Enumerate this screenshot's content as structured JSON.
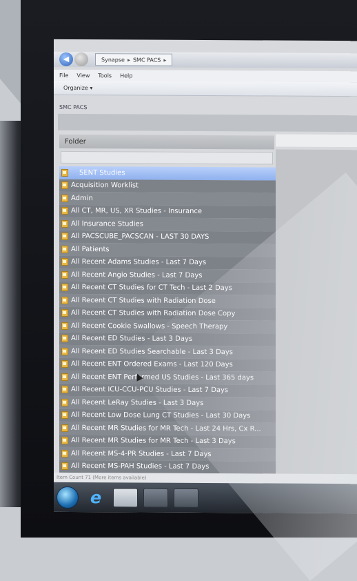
{
  "window": {
    "breadcrumb": [
      "Synapse",
      "SMC PACS"
    ],
    "menu": [
      "File",
      "View",
      "Tools",
      "Help"
    ],
    "toolbar_organize": "Organize ▾"
  },
  "pane": {
    "title": "SMC PACS",
    "folder_header": "Folder"
  },
  "folders": [
    "SENT Studies",
    "Acquisition Worklist",
    "Admin",
    "All CT, MR, US, XR Studies - Insurance",
    "All Insurance Studies",
    "All PACSCUBE_PACSCAN - LAST 30 DAYS",
    "All Patients",
    "All Recent Adams Studies - Last 7 Days",
    "All Recent Angio Studies - Last 7 Days",
    "All Recent CT Studies for CT Tech - Last 2 Days",
    "All Recent CT Studies with Radiation Dose",
    "All Recent CT Studies with Radiation Dose Copy",
    "All Recent Cookie Swallows - Speech Therapy",
    "All Recent ED Studies - Last 3 Days",
    "All Recent ED Studies Searchable - Last 3 Days",
    "All Recent ENT Ordered Exams - Last 120 Days",
    "All Recent ENT Performed US Studies - Last 365 days",
    "All Recent ICU-CCU-PCU Studies - Last 7 Days",
    "All Recent LeRay Studies - Last 3 Days",
    "All Recent Low Dose Lung CT Studies - Last 30 Days",
    "All Recent MR Studies for MR Tech - Last 24 Hrs, Cx R...",
    "All Recent MR Studies for MR Tech - Last 3 Days",
    "All Recent MS-4-PR Studies - Last 7 Days",
    "All Recent MS-PAH Studies - Last 7 Days"
  ],
  "selected_index": 0,
  "status": "Item Count 71 (More items available)",
  "taskbar": {
    "ie_glyph": "e"
  },
  "colors": {
    "selection": "#9bb8f2",
    "row": "#80848b",
    "folder_icon": "#e9b84a"
  }
}
